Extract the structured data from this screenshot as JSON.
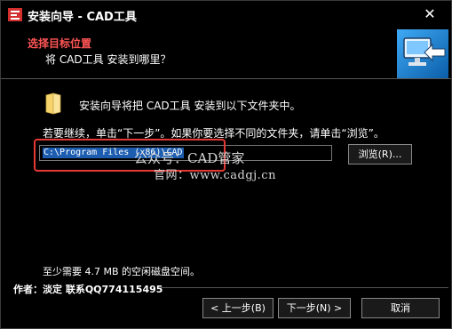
{
  "window": {
    "title": "安装向导 - CAD工具",
    "close_glyph": "✕"
  },
  "header": {
    "heading": "选择目标位置",
    "subheading": "将 CAD工具 安装到哪里？"
  },
  "body": {
    "description": "安装向导将把 CAD工具 安装到以下文件夹中。",
    "instruction": "若要继续，单击“下一步”。如果你要选择不同的文件夹，请单击“浏览”。",
    "path_value": "C:\\Program Files (x86)\\CAD",
    "browse_label": "浏览(R)...",
    "space_required": "至少需要 4.7 MB 的空闲磁盘空间。"
  },
  "watermark": {
    "line1": "公众号：CAD管家",
    "line2": "官网：www.cadgj.cn"
  },
  "footer": {
    "author": "作者：淡定  联系QQ774115495",
    "back_label": "< 上一步(B)",
    "next_label": "下一步(N) >",
    "cancel_label": "取消"
  },
  "colors": {
    "heading": "#ff5555",
    "selection": "#1c5db0",
    "highlight_box": "#e53935"
  }
}
